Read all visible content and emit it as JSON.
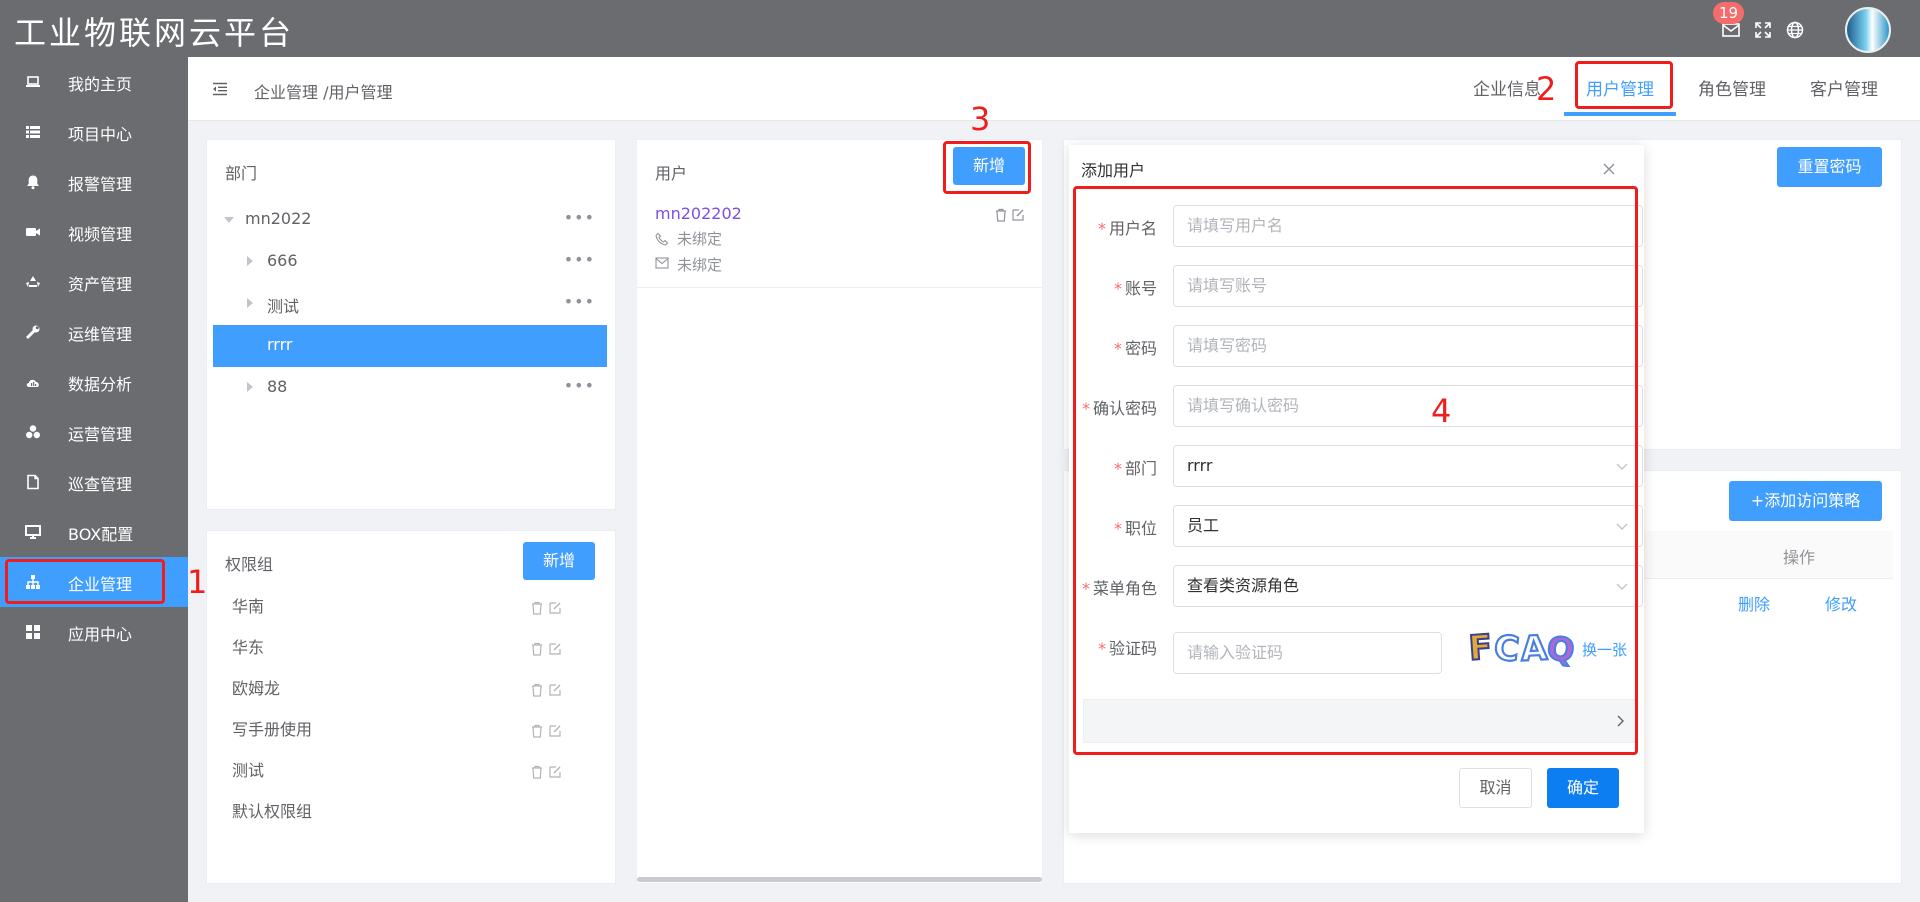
{
  "app": {
    "title": "工业物联网云平台",
    "notification_count": "19"
  },
  "sidebar": {
    "items": [
      {
        "label": "我的主页",
        "icon": "laptop-icon"
      },
      {
        "label": "项目中心",
        "icon": "list-icon"
      },
      {
        "label": "报警管理",
        "icon": "bell-icon"
      },
      {
        "label": "视频管理",
        "icon": "video-icon"
      },
      {
        "label": "资产管理",
        "icon": "recycle-icon"
      },
      {
        "label": "运维管理",
        "icon": "wrench-icon"
      },
      {
        "label": "数据分析",
        "icon": "cloud-chart-icon"
      },
      {
        "label": "运营管理",
        "icon": "cubes-icon"
      },
      {
        "label": "巡查管理",
        "icon": "document-icon"
      },
      {
        "label": "BOX配置",
        "icon": "monitor-icon"
      },
      {
        "label": "企业管理",
        "icon": "org-chart-icon",
        "active": true
      },
      {
        "label": "应用中心",
        "icon": "grid-icon"
      }
    ]
  },
  "breadcrumb": "企业管理 /用户管理",
  "tabs": [
    {
      "label": "企业信息"
    },
    {
      "label": "用户管理",
      "active": true
    },
    {
      "label": "角色管理"
    },
    {
      "label": "客户管理"
    }
  ],
  "dept_panel": {
    "title": "部门",
    "tree": [
      {
        "label": "mn2022",
        "level": 0,
        "expanded": true
      },
      {
        "label": "666",
        "level": 1
      },
      {
        "label": "测试",
        "level": 1
      },
      {
        "label": "rrrr",
        "level": 1,
        "selected": true
      },
      {
        "label": "88",
        "level": 1
      }
    ],
    "more": "•••"
  },
  "perm_panel": {
    "title": "权限组",
    "add_label": "新增",
    "groups": [
      "华南",
      "华东",
      "欧姆龙",
      "写手册使用",
      "测试",
      "默认权限组"
    ]
  },
  "user_panel": {
    "title": "用户",
    "add_label": "新增",
    "user": {
      "name": "mn202202",
      "phone": "未绑定",
      "email": "未绑定"
    }
  },
  "right_panel": {
    "reset_label": "重置密码",
    "add_policy_label": "+添加访问策略",
    "col_action": "操作",
    "delete_label": "删除",
    "edit_label": "修改"
  },
  "modal": {
    "title": "添加用户",
    "fields": {
      "username": {
        "label": "用户名",
        "placeholder": "请填写用户名"
      },
      "account": {
        "label": "账号",
        "placeholder": "请填写账号"
      },
      "password": {
        "label": "密码",
        "placeholder": "请填写密码"
      },
      "confirm": {
        "label": "确认密码",
        "placeholder": "请填写确认密码"
      },
      "dept": {
        "label": "部门",
        "value": "rrrr"
      },
      "position": {
        "label": "职位",
        "value": "员工"
      },
      "menu_role": {
        "label": "菜单角色",
        "value": "查看类资源角色"
      },
      "captcha": {
        "label": "验证码",
        "placeholder": "请输入验证码",
        "image_text": "FCAQ",
        "refresh_label": "换一张"
      }
    },
    "required_mark": "*",
    "cancel_label": "取消",
    "confirm_label": "确定"
  },
  "annotations": [
    "1",
    "2",
    "3",
    "4"
  ],
  "colors": {
    "sidebar_bg": "#6b6c70",
    "accent": "#409eff",
    "annotation": "#f01d1d",
    "badge": "#f56c6c"
  }
}
